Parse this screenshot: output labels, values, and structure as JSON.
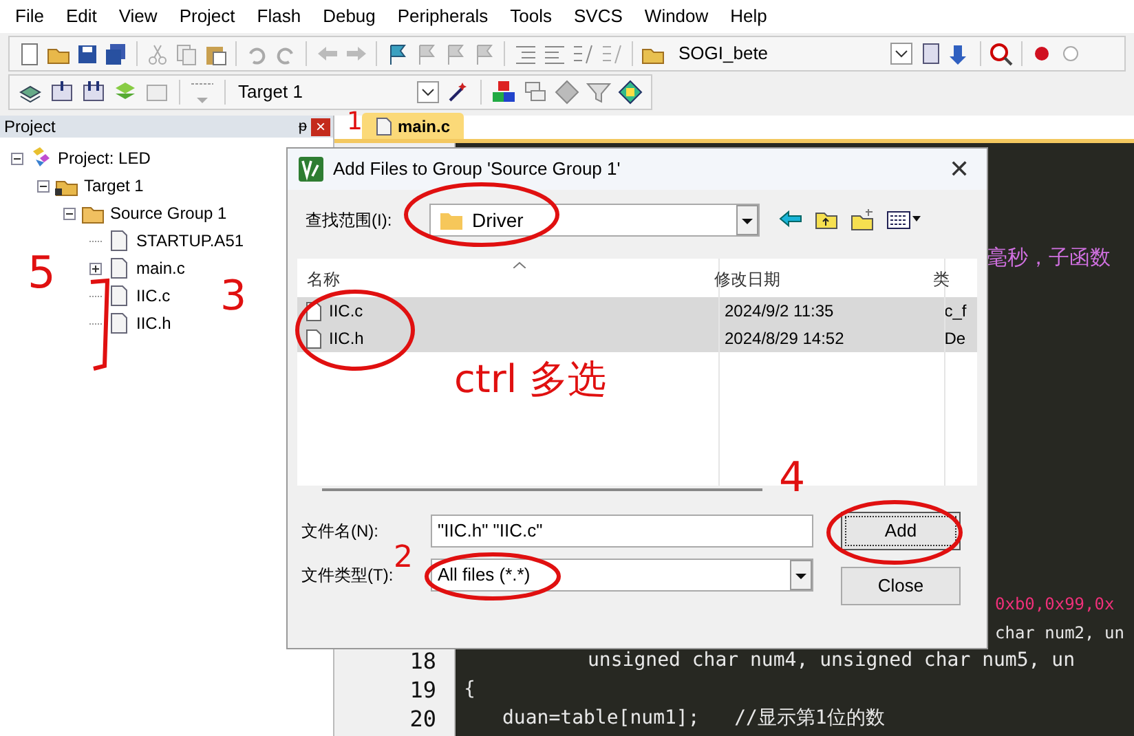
{
  "menu": [
    "File",
    "Edit",
    "View",
    "Project",
    "Flash",
    "Debug",
    "Peripherals",
    "Tools",
    "SVCS",
    "Window",
    "Help"
  ],
  "toolbar": {
    "target_combo": "SOGI_bete",
    "target_select": "Target 1"
  },
  "project_panel": {
    "title": "Project",
    "pin": "ᵽ",
    "close": "×",
    "tree": [
      {
        "label": "Project: LED",
        "kind": "project",
        "expanded": true,
        "children": [
          {
            "label": "Target 1",
            "kind": "target",
            "expanded": true,
            "children": [
              {
                "label": "Source Group 1",
                "kind": "group",
                "expanded": true,
                "children": [
                  {
                    "label": "STARTUP.A51",
                    "kind": "file"
                  },
                  {
                    "label": "main.c",
                    "kind": "file",
                    "expanded": false
                  },
                  {
                    "label": "IIC.c",
                    "kind": "file"
                  },
                  {
                    "label": "IIC.h",
                    "kind": "file"
                  }
                ]
              }
            ]
          }
        ]
      }
    ]
  },
  "editor": {
    "tab": "main.c",
    "code": [
      {
        "text": "毫秒，子函数",
        "kind": "comment"
      },
      {
        "text": "0xb0,0x99,0x",
        "kind": "hex"
      },
      {
        "text": "char num2, un",
        "kind": "decl"
      },
      {
        "number": "18",
        "text": "unsigned char num4, unsigned char num5, un",
        "kind": "decl"
      },
      {
        "number": "19",
        "text": "{",
        "kind": "plain"
      },
      {
        "number": "20",
        "text": "duan=table[num1];   //显示第1位的数",
        "kind": "plain"
      }
    ]
  },
  "dialog": {
    "title": "Add Files to Group 'Source Group 1'",
    "close": "✕",
    "look_in_label": "查找范围(I):",
    "look_in": "Driver",
    "columns": [
      "名称",
      "修改日期",
      "类"
    ],
    "files": [
      {
        "name": "IIC.c",
        "date": "2024/9/2 11:35",
        "type": "c_f",
        "selected": true
      },
      {
        "name": "IIC.h",
        "date": "2024/8/29 14:52",
        "type": "De",
        "selected": true
      }
    ],
    "filename_label": "文件名(N):",
    "filename": "\"IIC.h\" \"IIC.c\"",
    "filetype_label": "文件类型(T):",
    "filetype": "All files (*.*)",
    "buttons": [
      "Add",
      "Close"
    ]
  },
  "annotations": [
    "1",
    "2",
    "3",
    "4",
    "5",
    "ctrl 多选"
  ]
}
